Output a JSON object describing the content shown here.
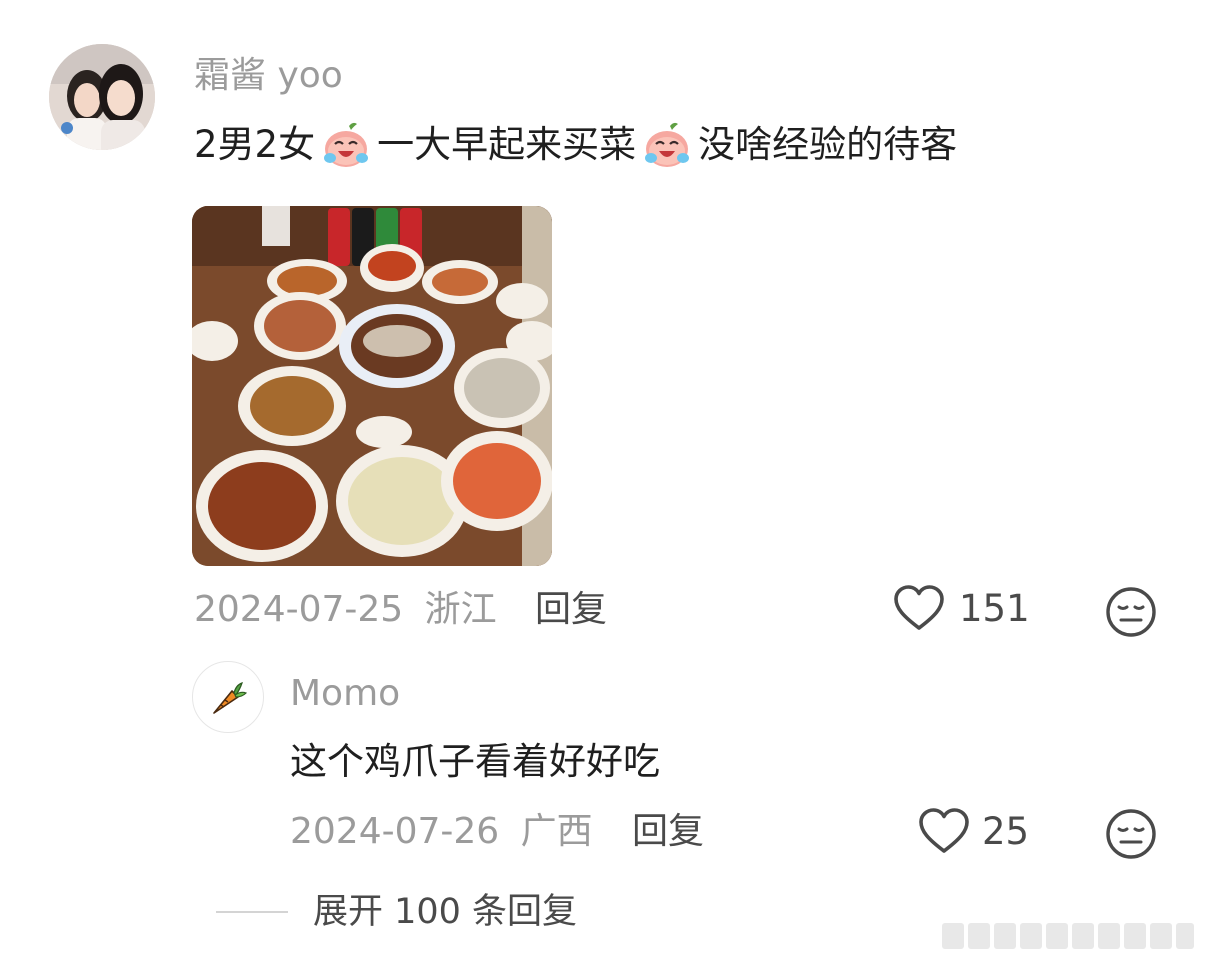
{
  "comment": {
    "username": "霜酱 yoo",
    "text_parts": [
      "2男2女",
      "一大早起来买菜",
      "没啥经验的待客"
    ],
    "emoji_name": "crying-laughing-emoji",
    "date": "2024-07-25",
    "location": "浙江",
    "reply_label": "回复",
    "like_count": "151",
    "image_alt": "dinner-table-photo"
  },
  "reply": {
    "username": "Momo",
    "text": "这个鸡爪子看着好好吃",
    "date": "2024-07-26",
    "location": "广西",
    "reply_label": "回复",
    "like_count": "25"
  },
  "expand": {
    "label": "展开 100 条回复"
  },
  "icons": {
    "like": "heart-outline-icon",
    "dislike": "meh-face-icon",
    "avatar_sub": "carrot-icon"
  },
  "colors": {
    "meta": "#9b9b9b",
    "text": "#1f1f1f",
    "action": "#4a4a4a"
  }
}
